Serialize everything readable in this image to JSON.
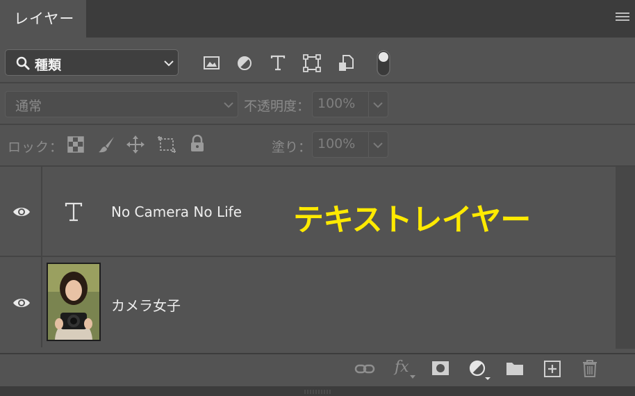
{
  "tab": {
    "title": "レイヤー"
  },
  "filter": {
    "kind_label": "種類"
  },
  "blend": {
    "mode": "通常",
    "opacity_label": "不透明度：",
    "opacity_value": "100%"
  },
  "lock": {
    "label": "ロック：",
    "fill_label": "塗り：",
    "fill_value": "100%"
  },
  "layers": [
    {
      "name": "No Camera No Life",
      "type": "text",
      "visible": true
    },
    {
      "name": "カメラ女子",
      "type": "image",
      "visible": true
    }
  ],
  "annotation": {
    "text": "テキストレイヤー",
    "color": "#ffea00"
  },
  "bottom_toolbar": {
    "fx_label": "fx"
  }
}
